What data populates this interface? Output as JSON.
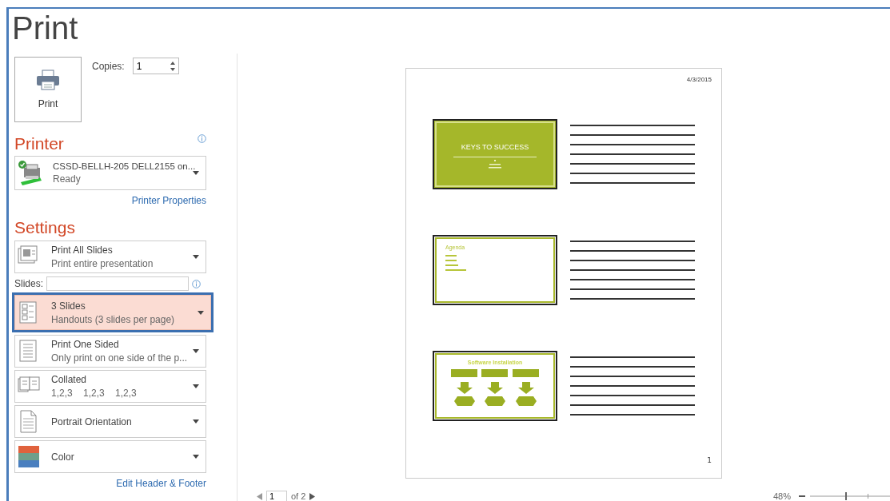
{
  "title": "Print",
  "print_button": {
    "label": "Print"
  },
  "copies": {
    "label": "Copies:",
    "value": "1"
  },
  "printer": {
    "heading": "Printer",
    "name": "CSSD-BELLH-205 DELL2155 on...",
    "status": "Ready",
    "properties_link": "Printer Properties"
  },
  "settings": {
    "heading": "Settings",
    "items": [
      {
        "kind": "range",
        "title": "Print All Slides",
        "detail": "Print entire presentation",
        "selected": false
      },
      {
        "kind": "slides_field",
        "label": "Slides:"
      },
      {
        "kind": "layout",
        "title": "3 Slides",
        "detail": "Handouts (3 slides per page)",
        "selected": true
      },
      {
        "kind": "sides",
        "title": "Print One Sided",
        "detail": "Only print on one side of the p...",
        "selected": false
      },
      {
        "kind": "collate",
        "title": "Collated",
        "detail": "1,2,3    1,2,3    1,2,3",
        "selected": false
      },
      {
        "kind": "orientation",
        "title": "Portrait Orientation",
        "selected": false
      },
      {
        "kind": "color",
        "title": "Color",
        "selected": false
      }
    ],
    "footer_link": "Edit Header & Footer"
  },
  "preview": {
    "date": "4/3/2015",
    "page_number": "1",
    "slides": [
      {
        "kind": "title",
        "title": "KEYS TO SUCCESS"
      },
      {
        "kind": "bullets",
        "title": "Agenda"
      },
      {
        "kind": "diagram",
        "title": "Software Installation"
      }
    ]
  },
  "navigation": {
    "page": "1",
    "of": "of 2"
  },
  "zoom": {
    "reading": "48%"
  }
}
